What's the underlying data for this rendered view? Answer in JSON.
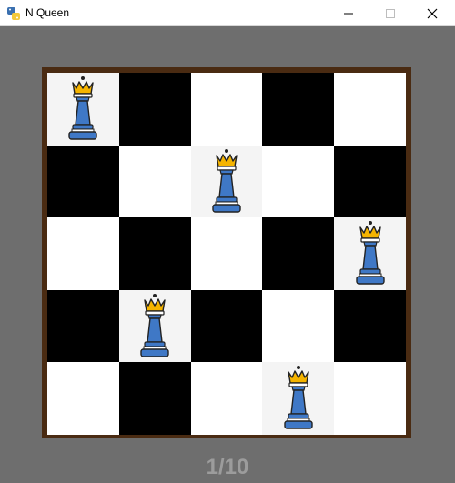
{
  "window": {
    "title": "N Queen",
    "icon": "python-icon",
    "controls": [
      "minimize-icon",
      "maximize-icon",
      "close-icon"
    ]
  },
  "board": {
    "size": 5,
    "light_color": "#ffffff",
    "dark_color": "#000000",
    "frame_color": "#4a2b12",
    "queen_color": "#3f78c6",
    "crown_color": "#f5b400",
    "queens": [
      {
        "row": 0,
        "col": 0
      },
      {
        "row": 1,
        "col": 2
      },
      {
        "row": 2,
        "col": 4
      },
      {
        "row": 3,
        "col": 1
      },
      {
        "row": 4,
        "col": 3
      }
    ]
  },
  "solution_counter": "1/10"
}
